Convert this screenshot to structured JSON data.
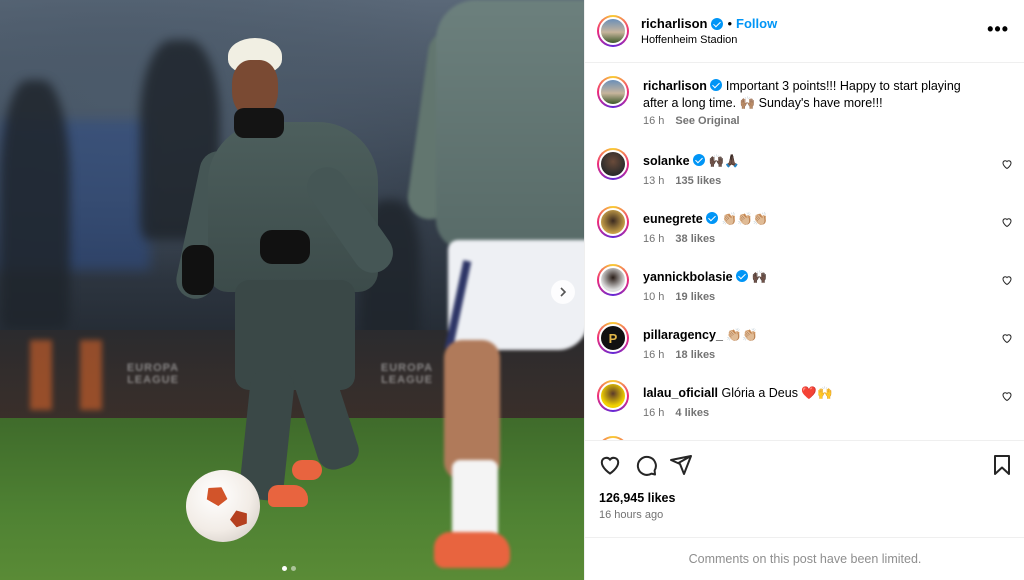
{
  "post": {
    "username": "richarlison",
    "follow_label": "Follow",
    "separator": "•",
    "location": "Hoffenheim Stadion",
    "more_label": "•••",
    "caption": {
      "username": "richarlison",
      "text": "Important 3 points!!! Happy to start playing after a long time. 🙌🏽 Sunday's have more!!!",
      "time": "16 h",
      "see_original": "See Original"
    },
    "board_logo_1": "EUROPA LEAGUE",
    "board_logo_2": "EUROPA LEAGUE"
  },
  "comments": [
    {
      "username": "solanke",
      "verified": true,
      "text": "🙌🏿🙏🏿",
      "time": "13 h",
      "likes": "135 likes"
    },
    {
      "username": "eunegrete",
      "verified": true,
      "text": "👏🏼👏🏼👏🏼",
      "time": "16 h",
      "likes": "38 likes"
    },
    {
      "username": "yannickbolasie",
      "verified": true,
      "text": "🙌🏿",
      "time": "10 h",
      "likes": "19 likes"
    },
    {
      "username": "pillaragency_",
      "verified": false,
      "text": "👏🏼👏🏼",
      "time": "16 h",
      "likes": "18 likes",
      "avatar_letter": "P"
    },
    {
      "username": "lalau_oficiall",
      "verified": false,
      "text": "Glória a Deus ❤️🙌",
      "time": "16 h",
      "likes": "4 likes"
    }
  ],
  "footer": {
    "likes": "126,945 likes",
    "time_ago": "16 hours ago",
    "limited": "Comments on this post have been limited."
  },
  "icons": [
    "heart-icon",
    "comment-icon",
    "share-icon",
    "bookmark-icon",
    "more-icon",
    "verified-icon",
    "chevron-right-icon"
  ],
  "colors": {
    "accent": "#0095f6",
    "muted": "#737373",
    "border": "#efefef",
    "boot": "#e8643f"
  },
  "carousel": {
    "slides": 2,
    "active": 1
  }
}
